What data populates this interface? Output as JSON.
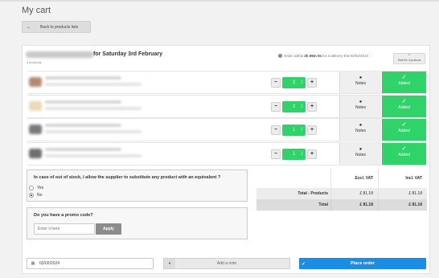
{
  "page": {
    "title": "My cart",
    "back_label": "Back to products lists"
  },
  "supplier": {
    "date_label": "for Saturday 3rd February",
    "product_count": "4 products",
    "order_within_prefix": "Order within",
    "order_within_time": "3h 59m 9s",
    "order_within_suffix": "for a delivery the 03/02/2024",
    "hide_label": "Hide the 4 products"
  },
  "items": [
    {
      "qty": "2",
      "notes_label": "Notes",
      "added_label": "Added",
      "thumb_color": "#b58a73"
    },
    {
      "qty": "2",
      "notes_label": "Notes",
      "added_label": "Added",
      "thumb_color": "#e9d9b5"
    },
    {
      "qty": "1",
      "notes_label": "Notes",
      "added_label": "Added",
      "thumb_color": "#7a7a7a"
    },
    {
      "qty": "1",
      "notes_label": "Notes",
      "added_label": "Added",
      "thumb_color": "#6f6f6f"
    }
  ],
  "substitute": {
    "question": "In case of out of stock, I allow the supplier to substitute any product with an equivalent ?",
    "yes_label": "Yes",
    "no_label": "No",
    "selected": "No"
  },
  "promo": {
    "question": "Do you have a promo code?",
    "placeholder": "Enter it here",
    "apply_label": "Apply"
  },
  "totals": {
    "header": {
      "excl": "Excl. VAT",
      "incl": "Incl. VAT"
    },
    "rows": [
      {
        "label": "Total - Products",
        "excl": "£ 81.18",
        "incl": "£ 81.18"
      },
      {
        "label": "Total",
        "excl": "£ 81.18",
        "incl": "£ 81.18"
      }
    ]
  },
  "footer": {
    "date_value": "03/02/2024",
    "note_label": "Add a note",
    "place_order_label": "Place order"
  },
  "colors": {
    "accent_green": "#2fd36a",
    "accent_blue": "#1a8de6"
  }
}
